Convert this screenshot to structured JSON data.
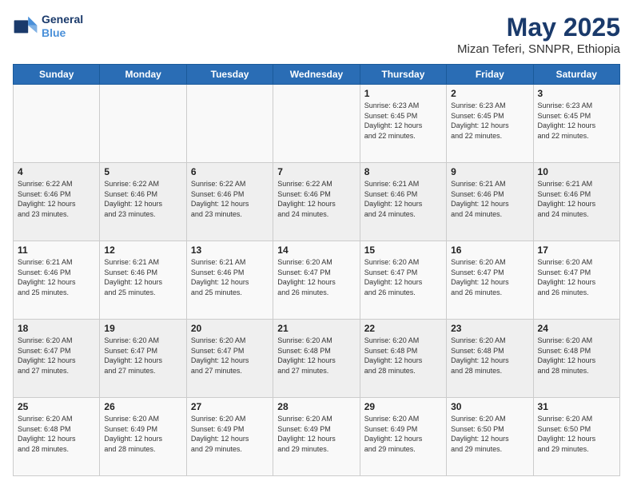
{
  "logo": {
    "line1": "General",
    "line2": "Blue"
  },
  "title": "May 2025",
  "subtitle": "Mizan Teferi, SNNPR, Ethiopia",
  "header_days": [
    "Sunday",
    "Monday",
    "Tuesday",
    "Wednesday",
    "Thursday",
    "Friday",
    "Saturday"
  ],
  "weeks": [
    [
      {
        "day": "",
        "info": ""
      },
      {
        "day": "",
        "info": ""
      },
      {
        "day": "",
        "info": ""
      },
      {
        "day": "",
        "info": ""
      },
      {
        "day": "1",
        "info": "Sunrise: 6:23 AM\nSunset: 6:45 PM\nDaylight: 12 hours\nand 22 minutes."
      },
      {
        "day": "2",
        "info": "Sunrise: 6:23 AM\nSunset: 6:45 PM\nDaylight: 12 hours\nand 22 minutes."
      },
      {
        "day": "3",
        "info": "Sunrise: 6:23 AM\nSunset: 6:45 PM\nDaylight: 12 hours\nand 22 minutes."
      }
    ],
    [
      {
        "day": "4",
        "info": "Sunrise: 6:22 AM\nSunset: 6:46 PM\nDaylight: 12 hours\nand 23 minutes."
      },
      {
        "day": "5",
        "info": "Sunrise: 6:22 AM\nSunset: 6:46 PM\nDaylight: 12 hours\nand 23 minutes."
      },
      {
        "day": "6",
        "info": "Sunrise: 6:22 AM\nSunset: 6:46 PM\nDaylight: 12 hours\nand 23 minutes."
      },
      {
        "day": "7",
        "info": "Sunrise: 6:22 AM\nSunset: 6:46 PM\nDaylight: 12 hours\nand 24 minutes."
      },
      {
        "day": "8",
        "info": "Sunrise: 6:21 AM\nSunset: 6:46 PM\nDaylight: 12 hours\nand 24 minutes."
      },
      {
        "day": "9",
        "info": "Sunrise: 6:21 AM\nSunset: 6:46 PM\nDaylight: 12 hours\nand 24 minutes."
      },
      {
        "day": "10",
        "info": "Sunrise: 6:21 AM\nSunset: 6:46 PM\nDaylight: 12 hours\nand 24 minutes."
      }
    ],
    [
      {
        "day": "11",
        "info": "Sunrise: 6:21 AM\nSunset: 6:46 PM\nDaylight: 12 hours\nand 25 minutes."
      },
      {
        "day": "12",
        "info": "Sunrise: 6:21 AM\nSunset: 6:46 PM\nDaylight: 12 hours\nand 25 minutes."
      },
      {
        "day": "13",
        "info": "Sunrise: 6:21 AM\nSunset: 6:46 PM\nDaylight: 12 hours\nand 25 minutes."
      },
      {
        "day": "14",
        "info": "Sunrise: 6:20 AM\nSunset: 6:47 PM\nDaylight: 12 hours\nand 26 minutes."
      },
      {
        "day": "15",
        "info": "Sunrise: 6:20 AM\nSunset: 6:47 PM\nDaylight: 12 hours\nand 26 minutes."
      },
      {
        "day": "16",
        "info": "Sunrise: 6:20 AM\nSunset: 6:47 PM\nDaylight: 12 hours\nand 26 minutes."
      },
      {
        "day": "17",
        "info": "Sunrise: 6:20 AM\nSunset: 6:47 PM\nDaylight: 12 hours\nand 26 minutes."
      }
    ],
    [
      {
        "day": "18",
        "info": "Sunrise: 6:20 AM\nSunset: 6:47 PM\nDaylight: 12 hours\nand 27 minutes."
      },
      {
        "day": "19",
        "info": "Sunrise: 6:20 AM\nSunset: 6:47 PM\nDaylight: 12 hours\nand 27 minutes."
      },
      {
        "day": "20",
        "info": "Sunrise: 6:20 AM\nSunset: 6:47 PM\nDaylight: 12 hours\nand 27 minutes."
      },
      {
        "day": "21",
        "info": "Sunrise: 6:20 AM\nSunset: 6:48 PM\nDaylight: 12 hours\nand 27 minutes."
      },
      {
        "day": "22",
        "info": "Sunrise: 6:20 AM\nSunset: 6:48 PM\nDaylight: 12 hours\nand 28 minutes."
      },
      {
        "day": "23",
        "info": "Sunrise: 6:20 AM\nSunset: 6:48 PM\nDaylight: 12 hours\nand 28 minutes."
      },
      {
        "day": "24",
        "info": "Sunrise: 6:20 AM\nSunset: 6:48 PM\nDaylight: 12 hours\nand 28 minutes."
      }
    ],
    [
      {
        "day": "25",
        "info": "Sunrise: 6:20 AM\nSunset: 6:48 PM\nDaylight: 12 hours\nand 28 minutes."
      },
      {
        "day": "26",
        "info": "Sunrise: 6:20 AM\nSunset: 6:49 PM\nDaylight: 12 hours\nand 28 minutes."
      },
      {
        "day": "27",
        "info": "Sunrise: 6:20 AM\nSunset: 6:49 PM\nDaylight: 12 hours\nand 29 minutes."
      },
      {
        "day": "28",
        "info": "Sunrise: 6:20 AM\nSunset: 6:49 PM\nDaylight: 12 hours\nand 29 minutes."
      },
      {
        "day": "29",
        "info": "Sunrise: 6:20 AM\nSunset: 6:49 PM\nDaylight: 12 hours\nand 29 minutes."
      },
      {
        "day": "30",
        "info": "Sunrise: 6:20 AM\nSunset: 6:50 PM\nDaylight: 12 hours\nand 29 minutes."
      },
      {
        "day": "31",
        "info": "Sunrise: 6:20 AM\nSunset: 6:50 PM\nDaylight: 12 hours\nand 29 minutes."
      }
    ]
  ]
}
